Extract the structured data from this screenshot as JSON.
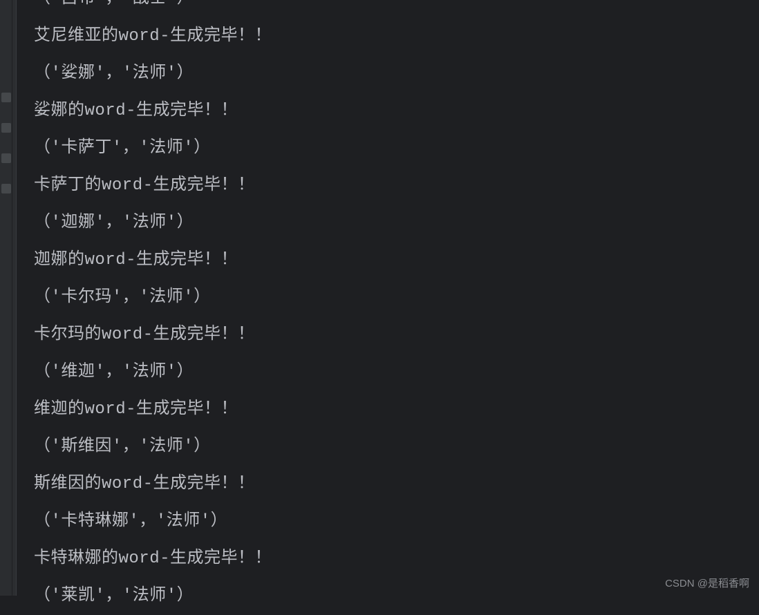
{
  "console": {
    "lines": [
      "（'吕布'，'战士'）",
      "艾尼维亚的word-生成完毕！！",
      "（'娑娜'，'法师'）",
      "娑娜的word-生成完毕！！",
      "（'卡萨丁'，'法师'）",
      "卡萨丁的word-生成完毕！！",
      "（'迦娜'，'法师'）",
      "迦娜的word-生成完毕！！",
      "（'卡尔玛'，'法师'）",
      "卡尔玛的word-生成完毕！！",
      "（'维迦'，'法师'）",
      "维迦的word-生成完毕！！",
      "（'斯维因'，'法师'）",
      "斯维因的word-生成完毕！！",
      "（'卡特琳娜'，'法师'）",
      "卡特琳娜的word-生成完毕！！",
      "（'莱凯'，'法师'）"
    ]
  },
  "watermark": {
    "text": "CSDN @是稻香啊"
  }
}
